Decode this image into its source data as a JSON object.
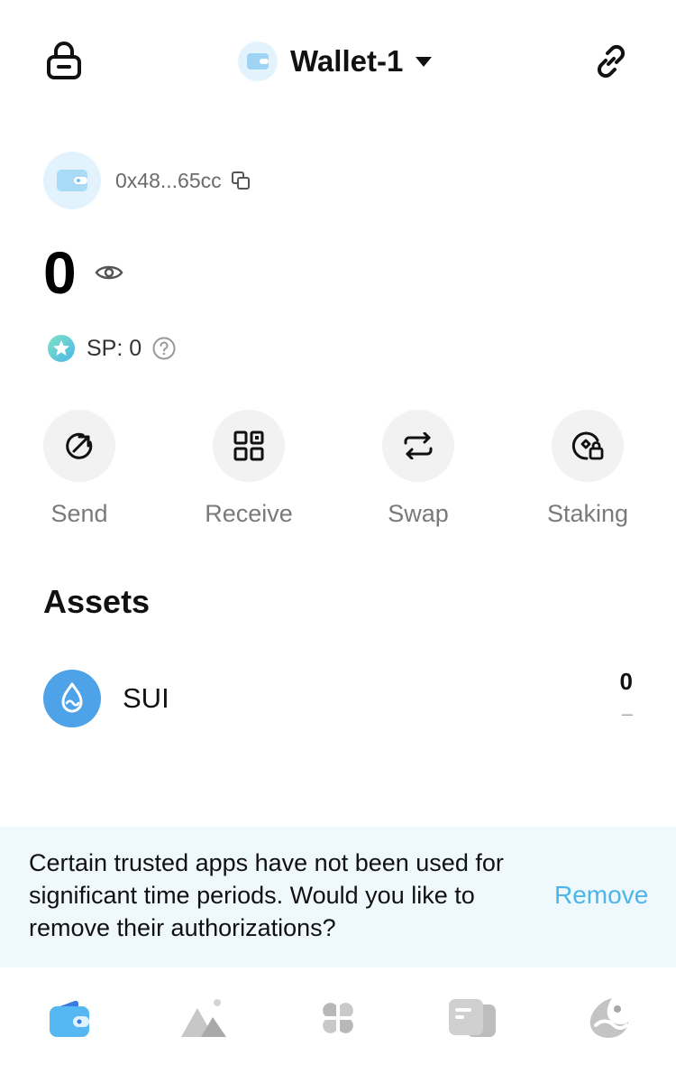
{
  "header": {
    "wallet_name": "Wallet-1",
    "icons": {
      "left": "lock-icon",
      "center": "wallet-icon",
      "right": "link-icon"
    }
  },
  "account": {
    "address": "0x48...65cc",
    "balance": "0",
    "sp_label": "SP: 0"
  },
  "actions": [
    {
      "label": "Send",
      "icon": "send-arrow-icon"
    },
    {
      "label": "Receive",
      "icon": "qr-code-icon"
    },
    {
      "label": "Swap",
      "icon": "swap-arrows-icon"
    },
    {
      "label": "Staking",
      "icon": "staking-icon"
    }
  ],
  "assets": {
    "title": "Assets",
    "items": [
      {
        "symbol": "SUI",
        "amount": "0",
        "value": "–"
      }
    ]
  },
  "banner": {
    "message": "Certain trusted apps have not been used for significant time periods. Would you like to remove their authorizations?",
    "button_label": "Remove"
  },
  "tabs": [
    {
      "name": "wallet-tab",
      "icon": "wallet-icon",
      "active": true
    },
    {
      "name": "nft-tab",
      "icon": "mountains-icon",
      "active": false
    },
    {
      "name": "apps-tab",
      "icon": "clover-icon",
      "active": false
    },
    {
      "name": "cards-tab",
      "icon": "cards-icon",
      "active": false
    },
    {
      "name": "sui-tab",
      "icon": "sui-wave-icon",
      "active": false
    }
  ],
  "colors": {
    "accent": "#4BB6E7",
    "banner_bg": "#EEF8FD",
    "sui_blue": "#4DA2E8",
    "action_bg": "#F2F2F2"
  }
}
